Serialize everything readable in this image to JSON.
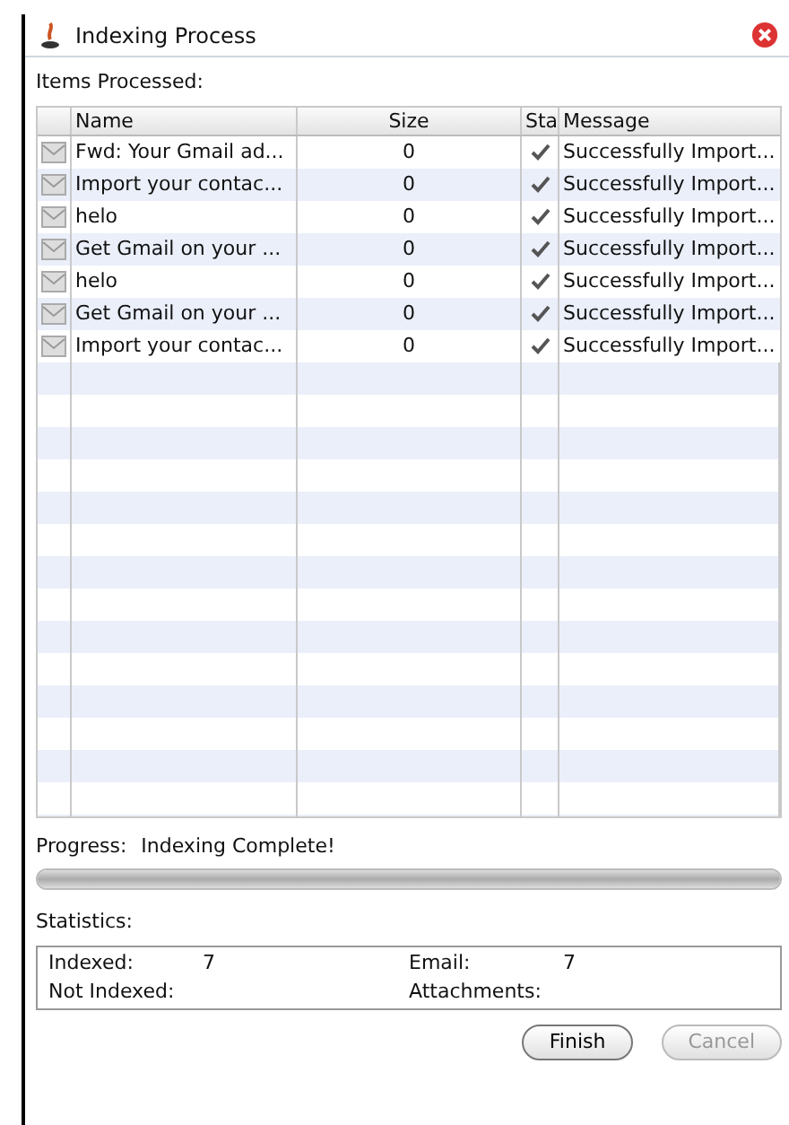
{
  "window": {
    "title": "Indexing Process"
  },
  "items_label": "Items Processed:",
  "table": {
    "columns": [
      "Name",
      "Size",
      "Sta",
      "Message"
    ],
    "rows": [
      {
        "name": "Fwd: Your Gmail ad...",
        "size": "0",
        "message": "Successfully Import...",
        "done": true
      },
      {
        "name": "Import your contac...",
        "size": "0",
        "message": "Successfully Import...",
        "done": true
      },
      {
        "name": "helo",
        "size": "0",
        "message": "Successfully Import...",
        "done": true
      },
      {
        "name": "Get Gmail on your ...",
        "size": "0",
        "message": "Successfully Import...",
        "done": true
      },
      {
        "name": "helo",
        "size": "0",
        "message": "Successfully Import...",
        "done": true
      },
      {
        "name": "Get Gmail on your ...",
        "size": "0",
        "message": "Successfully Import...",
        "done": true
      },
      {
        "name": "Import your contac...",
        "size": "0",
        "message": "Successfully Import...",
        "done": true
      }
    ]
  },
  "progress": {
    "label": "Progress:",
    "status": "Indexing Complete!",
    "level": 1
  },
  "statistics": {
    "label": "Statistics:",
    "fields": [
      {
        "label": "Indexed:",
        "value": "7"
      },
      {
        "label": "Email:",
        "value": "7"
      },
      {
        "label": "Not Indexed:"
      },
      {
        "label": "Attachments:"
      }
    ]
  },
  "buttons": [
    {
      "label": "Finish",
      "disabled": false
    },
    {
      "label": "Cancel",
      "disabled": true
    }
  ]
}
